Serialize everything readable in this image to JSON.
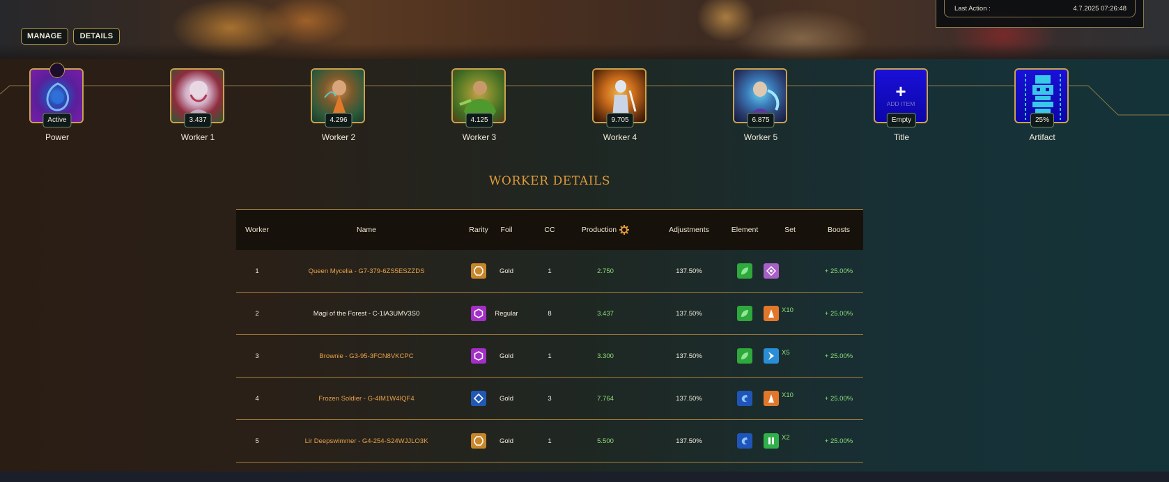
{
  "header": {
    "manage_label": "MANAGE",
    "details_label": "DETAILS",
    "last_action_label": "Last Action :",
    "last_action_value": "4.7.2025 07:26:48"
  },
  "slots": [
    {
      "label": "Power",
      "badge": "Active",
      "icon": "power-crystal-icon"
    },
    {
      "label": "Worker 1",
      "badge": "3.437",
      "icon": "worker-portrait-icon"
    },
    {
      "label": "Worker 2",
      "badge": "4.296",
      "icon": "worker-portrait-icon"
    },
    {
      "label": "Worker 3",
      "badge": "4.125",
      "icon": "worker-portrait-icon"
    },
    {
      "label": "Worker 4",
      "badge": "9.705",
      "icon": "worker-portrait-icon"
    },
    {
      "label": "Worker 5",
      "badge": "6.875",
      "icon": "worker-portrait-icon"
    },
    {
      "label": "Title",
      "badge": "Empty",
      "icon": "plus-icon",
      "add_text": "ADD ITEM",
      "add_symbol": "+"
    },
    {
      "label": "Artifact",
      "badge": "25%",
      "icon": "artifact-totem-icon"
    }
  ],
  "section_title": "WORKER DETAILS",
  "table": {
    "headers": {
      "worker": "Worker",
      "name": "Name",
      "rarity": "Rarity",
      "foil": "Foil",
      "cc": "CC",
      "production": "Production",
      "adjustments": "Adjustments",
      "element": "Element",
      "set": "Set",
      "boosts": "Boosts"
    },
    "rows": [
      {
        "worker": "1",
        "name": "Queen Mycelia - G7-379-6ZS5ESZZDS",
        "name_style": "gold",
        "rarity": "legendary",
        "rarity_color": "#c8862a",
        "foil": "Gold",
        "cc": "1",
        "production": "2.750",
        "adjustments": "137.50%",
        "element": "earth",
        "element_color": "#2fa83c",
        "set": "",
        "set_color": "#a860c8",
        "set_icon": "set-diamond-icon",
        "boosts": "+ 25.00%"
      },
      {
        "worker": "2",
        "name": "Magi of the Forest - C-1IA3UMV3S0",
        "name_style": "regular",
        "rarity": "epic",
        "rarity_color": "#a32fc6",
        "foil": "Regular",
        "cc": "8",
        "production": "3.437",
        "adjustments": "137.50%",
        "element": "earth",
        "element_color": "#2fa83c",
        "set": "X10",
        "set_color": "#e0772a",
        "set_icon": "set-spire-icon",
        "boosts": "+ 25.00%"
      },
      {
        "worker": "3",
        "name": "Brownie - G3-95-3FCN8VKCPC",
        "name_style": "gold",
        "rarity": "epic",
        "rarity_color": "#a32fc6",
        "foil": "Gold",
        "cc": "1",
        "production": "3.300",
        "adjustments": "137.50%",
        "element": "earth",
        "element_color": "#2fa83c",
        "set": "X5",
        "set_color": "#2a8ed6",
        "set_icon": "set-bolt-icon",
        "boosts": "+ 25.00%"
      },
      {
        "worker": "4",
        "name": "Frozen Soldier - G-4IM1W4IQF4",
        "name_style": "gold",
        "rarity": "rare",
        "rarity_color": "#2058b8",
        "foil": "Gold",
        "cc": "3",
        "production": "7.764",
        "adjustments": "137.50%",
        "element": "water",
        "element_color": "#1f55b8",
        "set": "X10",
        "set_color": "#e0772a",
        "set_icon": "set-spire-icon",
        "boosts": "+ 25.00%"
      },
      {
        "worker": "5",
        "name": "Lir Deepswimmer - G4-254-S24WJJLO3K",
        "name_style": "gold",
        "rarity": "legendary",
        "rarity_color": "#c8862a",
        "foil": "Gold",
        "cc": "1",
        "production": "5.500",
        "adjustments": "137.50%",
        "element": "water",
        "element_color": "#1f55b8",
        "set": "X2",
        "set_color": "#2fb04a",
        "set_icon": "set-pillars-icon",
        "boosts": "+ 25.00%"
      }
    ]
  }
}
